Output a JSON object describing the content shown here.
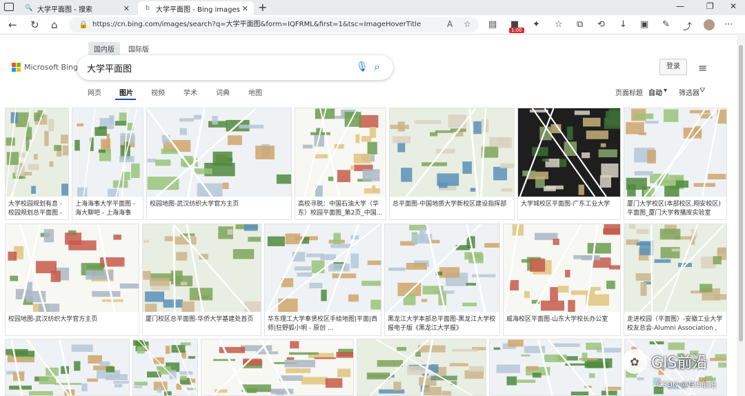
{
  "browser": {
    "tabs": [
      {
        "title": "大学平面图 - 搜索",
        "icon": "search-icon"
      },
      {
        "title": "大学平面图 - Bing images",
        "icon": "bing-icon"
      }
    ],
    "url": "https://cn.bing.com/images/search?q=大学平面图&form=IQFRML&first=1&tsc=ImageHoverTitle",
    "badge": "1.00"
  },
  "bing": {
    "region_tabs": [
      "国内版",
      "国际版"
    ],
    "logo_text": "Microsoft Bing",
    "search_query": "大学平面图",
    "login_label": "登录",
    "vertical_tabs": [
      "网页",
      "图片",
      "视频",
      "学术",
      "词典",
      "地图"
    ],
    "page_title_label": "页面标题",
    "page_title_value": "自动",
    "filter_label": "筛选器",
    "logo_colors": [
      "#f25022",
      "#7fba00",
      "#00a4ef",
      "#ffb900"
    ],
    "accent_color": "#174ae4"
  },
  "results": [
    {
      "caption": "大学校园规划有息 - 校园规划总平面图 - ..."
    },
    {
      "caption": "上海海事大学平面图 - 海大聊吧 - 上海海事大..."
    },
    {
      "caption": "校园地图-武汉纺织大学官方主页"
    },
    {
      "caption": "高校寻脱：中国石油大学（华东）校园平面图_第2页_中国..."
    },
    {
      "caption": "总平面图-中国地质大学新校区建设指挥部"
    },
    {
      "caption": "大学城校区平面图-广东工业大学"
    },
    {
      "caption": "厦门大学校区(本部校区,翔安校区)平面图_厦门大学救播库实验室"
    },
    {
      "caption": "校园地图-武汉纺织大学官方主页"
    },
    {
      "caption": "厦门校区总平面图-华侨大学基建处首页"
    },
    {
      "caption": "华东理工大学奉贤校区手绘地图|平面|西师|狂野狐小明 - 原创 ..."
    },
    {
      "caption": "黑龙江大学本部总平面图-黑龙江大学校报电子版《黑龙江大学报》"
    },
    {
      "caption": "威海校区平面图-山东大学校长办公室"
    },
    {
      "caption": "走进校园（平面图）-安徽工业大学校友总会-Alumni Association , Anhui ..."
    },
    {
      "caption": ""
    },
    {
      "caption": ""
    },
    {
      "caption": ""
    },
    {
      "caption": ""
    },
    {
      "caption": ""
    },
    {
      "caption": ""
    }
  ],
  "watermark": {
    "main": "GIS前沿",
    "csdn": "CSDN @GIS前沿"
  }
}
